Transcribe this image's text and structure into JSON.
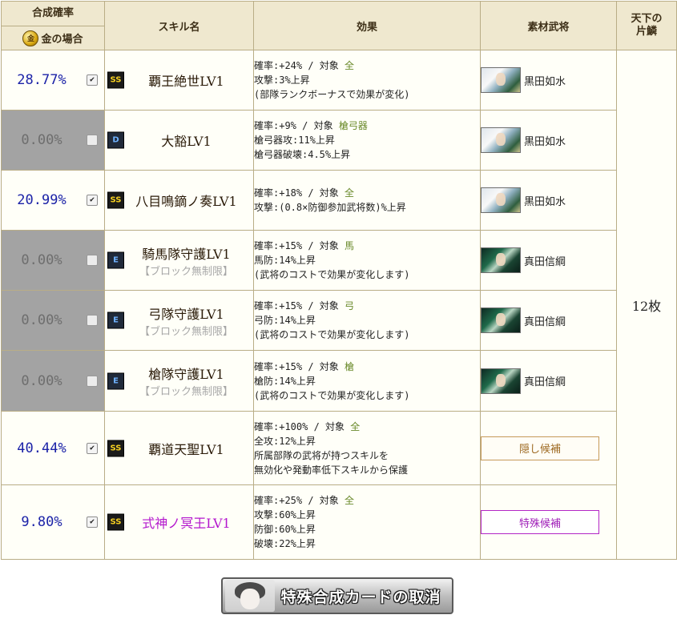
{
  "header": {
    "rate_title": "合成確率",
    "rate_sub": "金の場合",
    "coin_glyph": "金",
    "skill_name": "スキル名",
    "effect": "効果",
    "material": "素材武将",
    "tenka": "天下の\n片鱗"
  },
  "rows": [
    {
      "pct": "28.77%",
      "checked": true,
      "rank": "SS",
      "skill": "覇王絶世LV1",
      "note": "",
      "effect_lines": [
        "確率:+24% / 対象 ",
        "攻撃:3%上昇",
        "(部隊ランクボーナスで効果が変化)"
      ],
      "target": "全",
      "material": "黒田如水",
      "candidate": ""
    },
    {
      "pct": "0.00%",
      "checked": false,
      "rank": "D",
      "skill": "大豁LV1",
      "note": "",
      "effect_lines": [
        "確率:+9% / 対象 ",
        "槍弓器攻:11%上昇",
        "槍弓器破壊:4.5%上昇"
      ],
      "target": "槍弓器",
      "material": "黒田如水",
      "candidate": ""
    },
    {
      "pct": "20.99%",
      "checked": true,
      "rank": "SS",
      "skill": "八目鳴鏑ノ奏LV1",
      "note": "",
      "effect_lines": [
        "確率:+18% / 対象 ",
        "攻撃:(0.8×防御参加武将数)%上昇"
      ],
      "target": "全",
      "material": "黒田如水",
      "candidate": ""
    },
    {
      "pct": "0.00%",
      "checked": false,
      "rank": "E",
      "skill": "騎馬隊守護LV1",
      "note": "【ブロック無制限】",
      "effect_lines": [
        "確率:+15% / 対象 ",
        "馬防:14%上昇",
        "(武将のコストで効果が変化します)"
      ],
      "target": "馬",
      "material": "真田信綱",
      "candidate": ""
    },
    {
      "pct": "0.00%",
      "checked": false,
      "rank": "E",
      "skill": "弓隊守護LV1",
      "note": "【ブロック無制限】",
      "effect_lines": [
        "確率:+15% / 対象 ",
        "弓防:14%上昇",
        "(武将のコストで効果が変化します)"
      ],
      "target": "弓",
      "material": "真田信綱",
      "candidate": ""
    },
    {
      "pct": "0.00%",
      "checked": false,
      "rank": "E",
      "skill": "槍隊守護LV1",
      "note": "【ブロック無制限】",
      "effect_lines": [
        "確率:+15% / 対象 ",
        "槍防:14%上昇",
        "(武将のコストで効果が変化します)"
      ],
      "target": "槍",
      "material": "真田信綱",
      "candidate": ""
    },
    {
      "pct": "40.44%",
      "checked": true,
      "rank": "SS",
      "skill": "覇道天聖LV1",
      "note": "",
      "effect_lines": [
        "確率:+100% / 対象 ",
        "全攻:12%上昇",
        "所属部隊の武将が持つスキルを",
        "無効化や発動率低下スキルから保護"
      ],
      "target": "全",
      "material": "",
      "candidate": "隠し候補"
    },
    {
      "pct": "9.80%",
      "checked": true,
      "rank": "SS",
      "skill": "式神ノ冥王LV1",
      "note": "",
      "effect_lines": [
        "確率:+25% / 対象 ",
        "攻撃:60%上昇",
        "防御:60%上昇",
        "破壊:22%上昇"
      ],
      "target": "全",
      "material": "",
      "candidate": "特殊候補"
    }
  ],
  "tenka_count": "12枚",
  "cancel_button": "特殊合成カードの取消",
  "colors": {
    "percent_on": "#1c23a8",
    "percent_off_bg": "#a3a3a3",
    "target_green": "#6a8a2a",
    "special_purple": "#a020b8",
    "border": "#b9ad86",
    "header_bg": "#efe8cf"
  }
}
